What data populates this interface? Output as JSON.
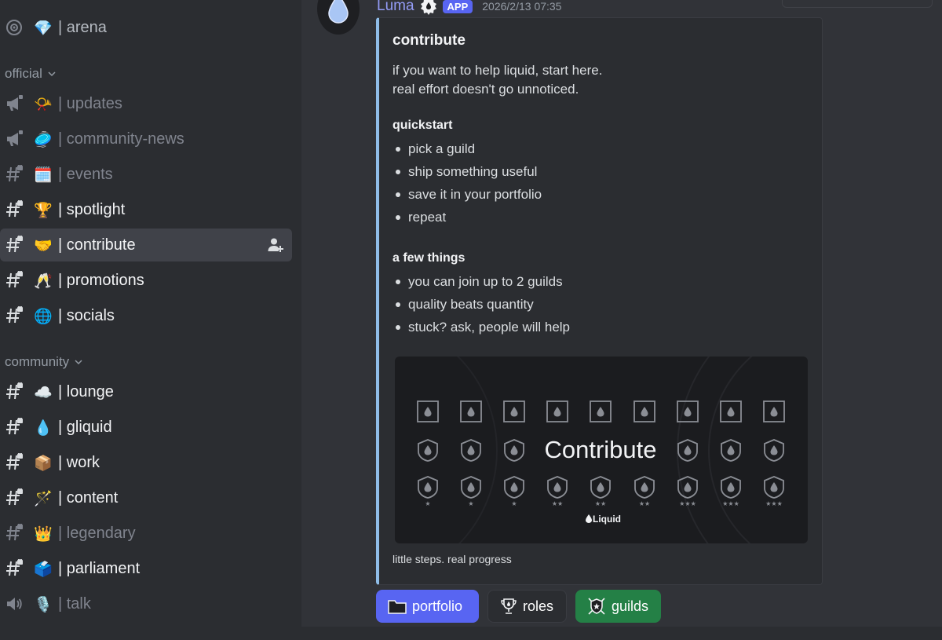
{
  "sidebar": {
    "channels_top": [
      {
        "kind": "stage",
        "emoji": "💎",
        "label": "arena",
        "state": "muted-light"
      }
    ],
    "categories": [
      {
        "name": "official",
        "channels": [
          {
            "kind": "announce",
            "emoji": "📯",
            "label": "updates",
            "state": "muted"
          },
          {
            "kind": "announce",
            "emoji": "🥏",
            "label": "community-news",
            "state": "muted"
          },
          {
            "kind": "text-locked",
            "emoji": "🗓️",
            "label": "events",
            "state": "muted"
          },
          {
            "kind": "text-locked",
            "emoji": "🏆",
            "label": "spotlight",
            "state": "bright"
          },
          {
            "kind": "text-locked",
            "emoji": "🤝",
            "label": "contribute",
            "state": "active"
          },
          {
            "kind": "text-locked",
            "emoji": "🥂",
            "label": "promotions",
            "state": "bright"
          },
          {
            "kind": "text-locked",
            "emoji": "🌐",
            "label": "socials",
            "state": "bright"
          }
        ]
      },
      {
        "name": "community",
        "channels": [
          {
            "kind": "text-locked",
            "emoji": "☁️",
            "label": "lounge",
            "state": "bright"
          },
          {
            "kind": "text-locked",
            "emoji": "💧",
            "label": "gliquid",
            "state": "bright"
          },
          {
            "kind": "text-locked",
            "emoji": "📦",
            "label": "work",
            "state": "bright"
          },
          {
            "kind": "text-locked",
            "emoji": "🪄",
            "label": "content",
            "state": "bright"
          },
          {
            "kind": "text-locked",
            "emoji": "👑",
            "label": "legendary",
            "state": "muted"
          },
          {
            "kind": "text-locked",
            "emoji": "🗳️",
            "label": "parliament",
            "state": "bright"
          },
          {
            "kind": "voice",
            "emoji": "🎙️",
            "label": "talk",
            "state": "muted"
          }
        ]
      }
    ],
    "separator": "|",
    "invite_icon": "add-member-icon"
  },
  "message": {
    "author": "Luma",
    "badge": "APP",
    "timestamp": "2026/2/13 07:35",
    "embed": {
      "accent_color": "#8fbde8",
      "title": "contribute",
      "intro_lines": [
        "if you want to help liquid, start here.",
        "real effort doesn't go unnoticed."
      ],
      "quickstart_heading": "quickstart",
      "quickstart_items": [
        "pick a guild",
        "ship something useful",
        "save it in your portfolio",
        "repeat"
      ],
      "things_heading": "a few things",
      "things_items": [
        "you can join up to 2 guilds",
        "quality beats quantity",
        "stuck? ask, people will help"
      ],
      "banner": {
        "title": "Contribute",
        "brand": "Liquid"
      },
      "caption": "little steps. real progress"
    },
    "buttons": [
      {
        "label": "portfolio",
        "icon": "folder-icon",
        "color": "#5865f2"
      },
      {
        "label": "roles",
        "icon": "trophy-icon",
        "color": "#2b2d31"
      },
      {
        "label": "guilds",
        "icon": "shield-swords-icon",
        "color": "#248046"
      }
    ]
  }
}
